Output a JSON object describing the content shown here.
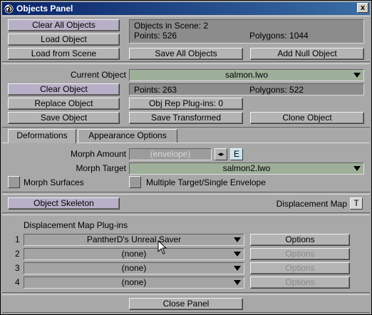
{
  "window": {
    "title": "Objects Panel",
    "close_glyph": "x"
  },
  "scene": {
    "clear_all": "Clear All Objects",
    "load_object": "Load Object",
    "load_from_scene": "Load from Scene",
    "objects_in_scene": "Objects in Scene: 2",
    "points": "Points: 526",
    "polygons": "Polygons: 1044",
    "save_all": "Save All Objects",
    "add_null": "Add Null Object"
  },
  "current": {
    "label": "Current Object",
    "value": "salmon.lwo",
    "clear_object": "Clear Object",
    "points": "Points: 263",
    "polygons": "Polygons: 522",
    "replace_object": "Replace Object",
    "obj_rep_plugins": "Obj Rep Plug-ins: 0",
    "save_object": "Save Object",
    "save_transformed": "Save Transformed",
    "clone_object": "Clone Object"
  },
  "tabs": [
    {
      "label": "Deformations",
      "active": true
    },
    {
      "label": "Appearance Options",
      "active": false
    }
  ],
  "deform": {
    "morph_amount_label": "Morph Amount",
    "morph_amount_value": "(envelope)",
    "envelope_button": "E",
    "morph_target_label": "Morph Target",
    "morph_target_value": "salmon2.lwo",
    "morph_surfaces": "Morph Surfaces",
    "multiple_target": "Multiple Target/Single Envelope"
  },
  "skeleton": {
    "object_skeleton": "Object Skeleton",
    "displacement_map_label": "Displacement Map",
    "displacement_map_button": "T"
  },
  "plugins": {
    "header": "Displacement Map Plug-ins",
    "rows": [
      {
        "num": "1",
        "value": "PantherD's Unreal Saver",
        "options": "Options",
        "enabled": true
      },
      {
        "num": "2",
        "value": "(none)",
        "options": "Options",
        "enabled": false
      },
      {
        "num": "3",
        "value": "(none)",
        "options": "Options",
        "enabled": false
      },
      {
        "num": "4",
        "value": "(none)",
        "options": "Options",
        "enabled": false
      }
    ]
  },
  "footer": {
    "close_panel": "Close Panel"
  },
  "icons": {
    "app": "lightwave-spiral-icon",
    "cursor": "mouse-pointer-icon",
    "arrows": "left-right-arrows-icon"
  }
}
